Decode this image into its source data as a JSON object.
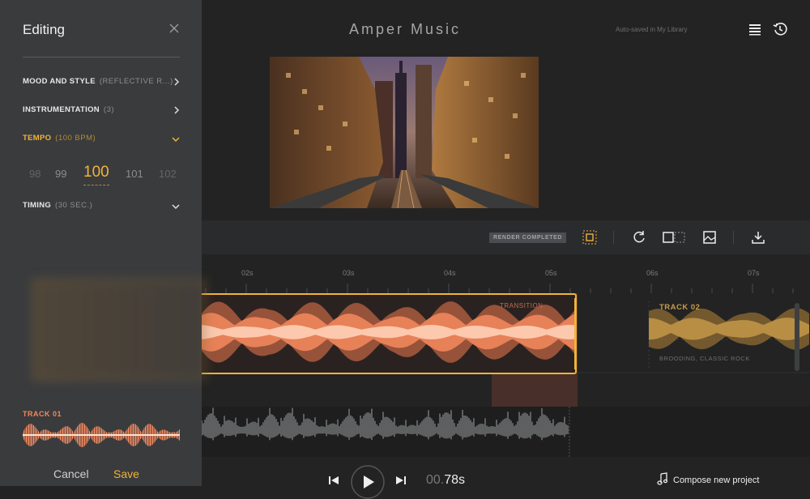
{
  "panel": {
    "title": "Editing",
    "items": [
      {
        "label": "MOOD AND STYLE",
        "value": "(REFLECTIVE R...)",
        "chevron": "chevron-right-icon"
      },
      {
        "label": "INSTRUMENTATION",
        "value": "(3)",
        "chevron": "chevron-right-icon"
      },
      {
        "label": "TEMPO",
        "value": "(100 BPM)",
        "chevron": "chevron-down-icon",
        "active": true
      },
      {
        "label": "TIMING",
        "value": "(30 SEC.)",
        "chevron": "chevron-down-icon"
      }
    ],
    "tempo_options": [
      "98",
      "99",
      "100",
      "101",
      "102"
    ],
    "tempo_selected": "100",
    "track_label": "TRACK 01",
    "cancel_label": "Cancel",
    "save_label": "Save"
  },
  "header": {
    "title": "Amper Music",
    "autosave": "Auto-saved in My Library",
    "icons": [
      "list-icon",
      "history-icon"
    ]
  },
  "toolbar": {
    "status_badge": "RENDER COMPLETED",
    "icons": [
      "fit-frame-icon",
      "refresh-icon",
      "split-view-icon",
      "image-icon",
      "download-icon"
    ]
  },
  "timeline": {
    "ticks": [
      "02s",
      "03s",
      "04s",
      "05s",
      "06s",
      "07s"
    ],
    "transition_label": "TRANSITION",
    "track2_label": "TRACK 02",
    "track2_sub": "BROODING, CLASSIC ROCK"
  },
  "transport": {
    "time_prefix": "00.",
    "time_value": "78s",
    "compose_label": "Compose new project"
  },
  "colors": {
    "accent": "#f0b43a",
    "track1": "#f07a50",
    "track2": "#b8863a",
    "panel_bg": "#3a3b3d",
    "bg": "#232323"
  }
}
